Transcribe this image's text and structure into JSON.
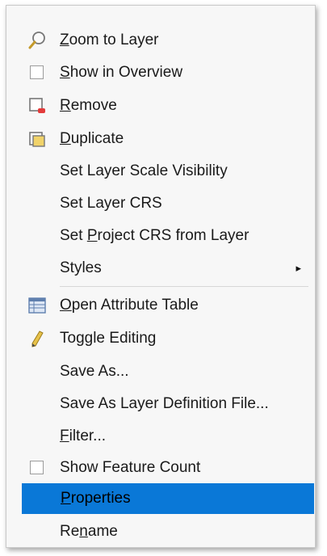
{
  "menu": {
    "items": [
      {
        "pre": "",
        "u": "Z",
        "post": "oom to Layer",
        "icon": "zoom-icon"
      },
      {
        "pre": "",
        "u": "S",
        "post": "how in Overview",
        "icon": "checkbox-icon"
      },
      {
        "pre": "",
        "u": "R",
        "post": "emove",
        "icon": "remove-layer-icon"
      },
      {
        "pre": "",
        "u": "D",
        "post": "uplicate",
        "icon": "duplicate-layer-icon"
      },
      {
        "pre": "Set Layer Scale Visibility",
        "u": "",
        "post": ""
      },
      {
        "pre": "Set Layer CRS",
        "u": "",
        "post": ""
      },
      {
        "pre": "Set ",
        "u": "P",
        "post": "roject CRS from Layer"
      },
      {
        "pre": "Styles",
        "u": "",
        "post": "",
        "submenu_arrow": "▸"
      },
      {
        "pre": "",
        "u": "O",
        "post": "pen Attribute Table",
        "icon": "attribute-table-icon"
      },
      {
        "pre": "Toggle Editing",
        "u": "",
        "post": "",
        "icon": "pencil-icon"
      },
      {
        "pre": "Save As...",
        "u": "",
        "post": ""
      },
      {
        "pre": "Save As Layer Definition File...",
        "u": "",
        "post": ""
      },
      {
        "pre": "",
        "u": "F",
        "post": "ilter...",
        "icon": ""
      },
      {
        "pre": "Show Feature Count",
        "u": "",
        "post": "",
        "icon": "checkbox-icon"
      },
      {
        "pre": "",
        "u": "P",
        "post": "roperties",
        "selected": true
      },
      {
        "pre": "Re",
        "u": "n",
        "post": "ame"
      }
    ],
    "selection_color": "#0a78d7"
  }
}
